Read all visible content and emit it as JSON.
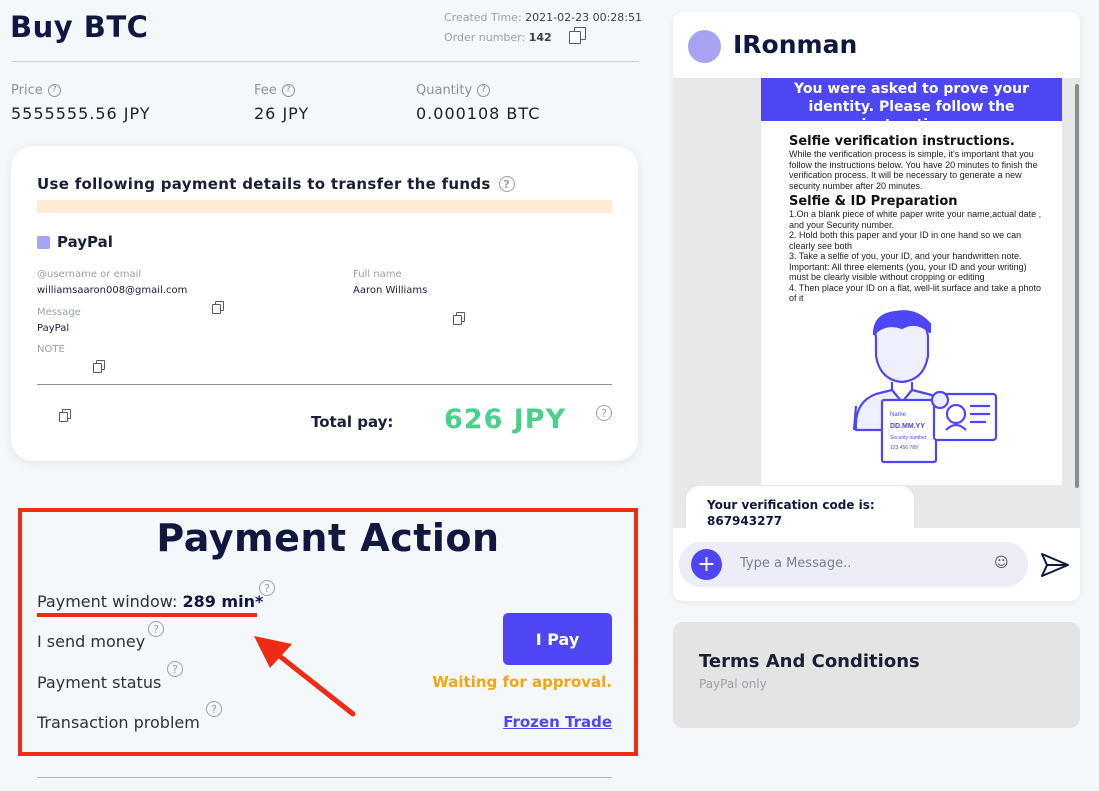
{
  "header": {
    "title": "Buy BTC",
    "created_label": "Created Time:",
    "created_value": "2021-02-23 00:28:51",
    "order_label": "Order number:",
    "order_value": "142"
  },
  "stats": {
    "price_label": "Price",
    "price_value": "5555555.56 JPY",
    "fee_label": "Fee",
    "fee_value": "26 JPY",
    "quantity_label": "Quantity",
    "quantity_value": "0.000108 BTC"
  },
  "payment_details": {
    "heading": "Use following payment details to transfer the funds",
    "method": "PayPal",
    "username_label": "@username or email",
    "username_value": "williamsaaron008@gmail.com",
    "fullname_label": "Full name",
    "fullname_value": "Aaron Williams",
    "message_label": "Message",
    "message_value": "PayPal",
    "note_label": "NOTE",
    "total_label": "Total pay:",
    "total_value": "626 JPY"
  },
  "action": {
    "title": "Payment Action",
    "window_label": "Payment window:",
    "window_value": "289 min*",
    "send_label": "I send money",
    "status_label": "Payment status",
    "problem_label": "Transaction problem",
    "pay_button": "I Pay",
    "status_value": "Waiting for approval.",
    "frozen_link": "Frozen Trade"
  },
  "chat": {
    "name": "IRonman",
    "doc_banner": "You were asked to prove your identity. Please follow the instructions.",
    "doc_h1": "Selfie verification instructions.",
    "doc_p1": "While the verification process is simple, it's important that you follow the instructions below. You have 20 minutes to finish the verification process. It will be necessary to generate a new security number after 20 minutes.",
    "doc_h2": "Selfie & ID Preparation",
    "doc_p2": "1.On a blank piece of white paper write your name,actual date , and your Security number.",
    "doc_p3": "2. Hold both this paper and your ID in one hand so we can clearly see both",
    "doc_p4": "3. Take a selfie of you, your ID, and your handwritten note. Important: All three elements (you, your ID and your writing) must be clearly visible without cropping or editing",
    "doc_p5": "4. Then place your ID on a flat, well-lit surface and take a photo of it",
    "card_name": "Name",
    "card_date": "DD.MM.YY",
    "card_security": "Security number",
    "card_number": "123 456 789",
    "bubble_line1": "Your verification code is:",
    "bubble_line2": "867943277",
    "input_placeholder": "Type a Message.."
  },
  "terms": {
    "title": "Terms And Conditions",
    "subtitle": "PayPal only"
  },
  "colors": {
    "accent": "#4e46f2",
    "success": "#4bd08b",
    "warning": "#f2a515",
    "highlight_red": "#ee2b14",
    "method_square": "#a6a3f2"
  },
  "icons": [
    "help-icon",
    "copy-icon",
    "plus-icon",
    "emoji-icon",
    "send-icon",
    "red-arrow-icon"
  ]
}
